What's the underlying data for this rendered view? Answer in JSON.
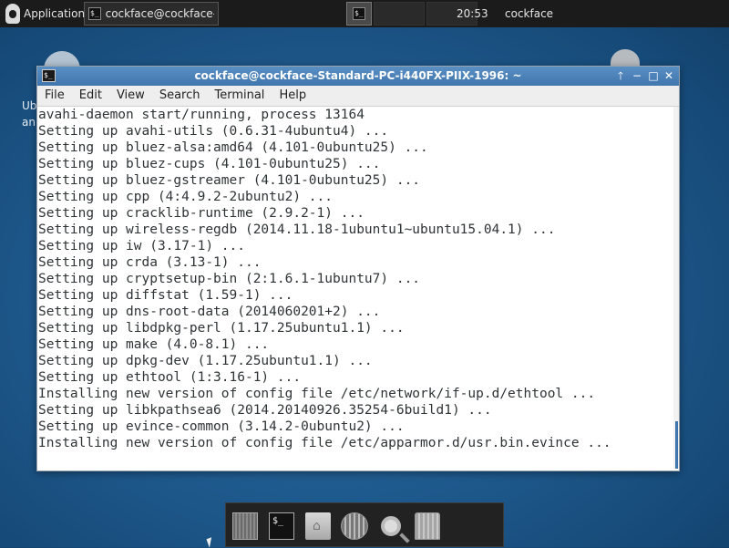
{
  "top_panel": {
    "applications_label": "Applications",
    "task_terminal_label": "cockface@cockface-Sta...",
    "clock": "20:53",
    "user": "cockface"
  },
  "desktop": {
    "partial_label_line1": "Ub",
    "partial_label_line2": "an"
  },
  "window": {
    "title": "cockface@cockface-Standard-PC-i440FX-PIIX-1996: ~",
    "menu": [
      "File",
      "Edit",
      "View",
      "Search",
      "Terminal",
      "Help"
    ],
    "lines": [
      "avahi-daemon start/running, process 13164",
      "Setting up avahi-utils (0.6.31-4ubuntu4) ...",
      "Setting up bluez-alsa:amd64 (4.101-0ubuntu25) ...",
      "Setting up bluez-cups (4.101-0ubuntu25) ...",
      "Setting up bluez-gstreamer (4.101-0ubuntu25) ...",
      "Setting up cpp (4:4.9.2-2ubuntu2) ...",
      "Setting up cracklib-runtime (2.9.2-1) ...",
      "Setting up wireless-regdb (2014.11.18-1ubuntu1~ubuntu15.04.1) ...",
      "Setting up iw (3.17-1) ...",
      "Setting up crda (3.13-1) ...",
      "Setting up cryptsetup-bin (2:1.6.1-1ubuntu7) ...",
      "Setting up diffstat (1.59-1) ...",
      "Setting up dns-root-data (2014060201+2) ...",
      "Setting up libdpkg-perl (1.17.25ubuntu1.1) ...",
      "Setting up make (4.0-8.1) ...",
      "Setting up dpkg-dev (1.17.25ubuntu1.1) ...",
      "Setting up ethtool (1:3.16-1) ...",
      "Installing new version of config file /etc/network/if-up.d/ethtool ...",
      "Setting up libkpathsea6 (2014.20140926.35254-6build1) ...",
      "Setting up evince-common (3.14.2-0ubuntu2) ...",
      "Installing new version of config file /etc/apparmor.d/usr.bin.evince ..."
    ]
  },
  "icons": {
    "terminal_glyph": "$_",
    "up": "🡑",
    "minimize": "−",
    "maximize": "□",
    "close": "✕"
  },
  "colors": {
    "titlebar": "#3f76ad",
    "panel": "#1b1b1b",
    "terminal_text": "#2e3436"
  }
}
